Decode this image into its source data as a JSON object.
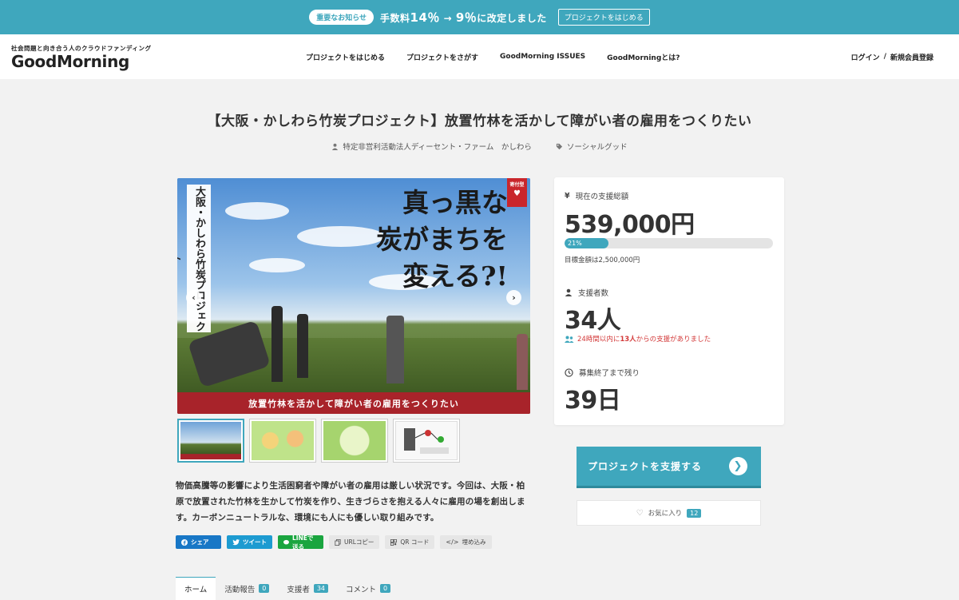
{
  "announcement": {
    "pill": "重要なお知らせ",
    "msg_prefix": "手数料",
    "old_rate": "14％",
    "arrow": "→",
    "new_rate": "9％",
    "msg_suffix": "に改定しました",
    "button": "プロジェクトをはじめる"
  },
  "header": {
    "tagline": "社会問題と向き合う人のクラウドファンディング",
    "logo": "GoodMorning",
    "nav": [
      "プロジェクトをはじめる",
      "プロジェクトをさがす",
      "GoodMorning ISSUES",
      "GoodMorningとは?"
    ],
    "login": "ログイン",
    "separator": "/",
    "signup": "新規会員登録"
  },
  "project": {
    "title": "【大阪・かしわら竹炭プロジェクト】放置竹林を活かして障がい者の雇用をつくりたい",
    "owner": "特定非営利活動法人ディーセント・ファーム　かしわら",
    "category": "ソーシャルグッド",
    "hero_vertical": "大阪・かしわら竹炭プロジェクト",
    "hero_catch": [
      "真っ黒な",
      "炭がまちを",
      "変える?!"
    ],
    "hero_ribbon": "寄付型",
    "hero_caption": "放置竹林を活かして障がい者の雇用をつくりたい",
    "description": "物価高騰等の影響により生活困窮者や障がい者の雇用は厳しい状況です。今回は、大阪・柏原で放置された竹林を生かして竹炭を作り、生きづらさを抱える人々に雇用の場を創出します。カーボンニュートラルな、環境にも人にも優しい取り組みです。"
  },
  "share": {
    "facebook": "シェア",
    "twitter": "ツイート",
    "line": "LINEで送る",
    "url": "URLコピー",
    "qr": "QR コード",
    "embed": "埋め込み"
  },
  "tabs": [
    {
      "label": "ホーム",
      "count": ""
    },
    {
      "label": "活動報告",
      "count": "0"
    },
    {
      "label": "支援者",
      "count": "34"
    },
    {
      "label": "コメント",
      "count": "0"
    }
  ],
  "stats": {
    "total_label": "現在の支援総額",
    "total_value": "539,000円",
    "progress_pct": "21%",
    "progress_fraction": 0.21,
    "goal": "目標金額は2,500,000円",
    "backers_label": "支援者数",
    "backers_value": "34人",
    "recent_prefix": "24時間以内に",
    "recent_count": "13人",
    "recent_suffix": "からの支援がありました",
    "remaining_label": "募集終了まで残り",
    "remaining_value": "39日"
  },
  "cta": {
    "label": "プロジェクトを支援する",
    "fav_label": "お気に入り",
    "fav_count": "12"
  },
  "colors": {
    "accent": "#3fa7bd",
    "caption_red": "#a8232a",
    "alert_red": "#d33a3a"
  }
}
